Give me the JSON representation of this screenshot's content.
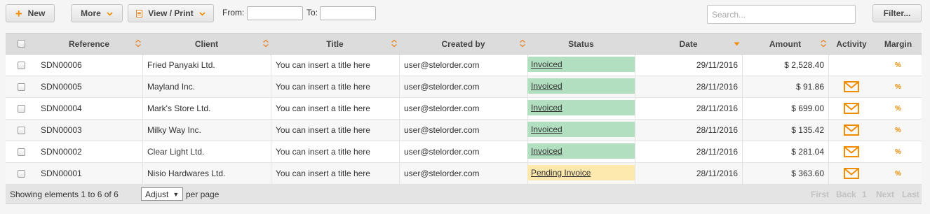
{
  "toolbar": {
    "new_label": "New",
    "more_label": "More",
    "view_print_label": "View / Print",
    "from_label": "From:",
    "to_label": "To:",
    "from_value": "",
    "to_value": "",
    "search_placeholder": "Search...",
    "filter_label": "Filter..."
  },
  "columns": [
    "Reference",
    "Client",
    "Title",
    "Created by",
    "Status",
    "Date",
    "Amount",
    "Activity",
    "Margin"
  ],
  "rows": [
    {
      "reference": "SDN00006",
      "client": "Fried Panyaki Ltd.",
      "title": "You can insert a title here",
      "created_by": "user@stelorder.com",
      "status": "Invoiced",
      "status_type": "invoiced",
      "date": "29/11/2016",
      "amount": "$ 2,528.40",
      "has_activity": false,
      "margin": "%"
    },
    {
      "reference": "SDN00005",
      "client": "Mayland Inc.",
      "title": "You can insert a title here",
      "created_by": "user@stelorder.com",
      "status": "Invoiced",
      "status_type": "invoiced",
      "date": "28/11/2016",
      "amount": "$ 91.86",
      "has_activity": true,
      "margin": "%"
    },
    {
      "reference": "SDN00004",
      "client": "Mark's Store Ltd.",
      "title": "You can insert a title here",
      "created_by": "user@stelorder.com",
      "status": "Invoiced",
      "status_type": "invoiced",
      "date": "28/11/2016",
      "amount": "$ 699.00",
      "has_activity": true,
      "margin": "%"
    },
    {
      "reference": "SDN00003",
      "client": "Milky Way Inc.",
      "title": "You can insert a title here",
      "created_by": "user@stelorder.com",
      "status": "Invoiced",
      "status_type": "invoiced",
      "date": "28/11/2016",
      "amount": "$ 135.42",
      "has_activity": true,
      "margin": "%"
    },
    {
      "reference": "SDN00002",
      "client": "Clear Light Ltd.",
      "title": "You can insert a title here",
      "created_by": "user@stelorder.com",
      "status": "Invoiced",
      "status_type": "invoiced",
      "date": "28/11/2016",
      "amount": "$ 281.04",
      "has_activity": true,
      "margin": "%"
    },
    {
      "reference": "SDN00001",
      "client": "Nisio Hardwares Ltd.",
      "title": "You can insert a title here",
      "created_by": "user@stelorder.com",
      "status": "Pending Invoice",
      "status_type": "pending",
      "date": "28/11/2016",
      "amount": "$ 363.60",
      "has_activity": true,
      "margin": "%"
    }
  ],
  "footer": {
    "showing": "Showing elements 1 to 6 of 6",
    "adjust_label": "Adjust",
    "per_page": "per page",
    "first": "First",
    "back": "Back",
    "page": "1",
    "next": "Next",
    "last": "Last"
  },
  "colors": {
    "accent": "#f08c00",
    "invoiced_bg": "#b3dfc1",
    "pending_bg": "#fde9ad",
    "header_bg": "#dcdcdc",
    "pager_disabled": "#c2c2c2"
  },
  "icons": {
    "new": "plus-icon",
    "dropdown": "chevron-down-icon",
    "print": "document-icon",
    "sort": "sort-icon",
    "activity": "envelope-icon",
    "margin": "percent-icon"
  }
}
